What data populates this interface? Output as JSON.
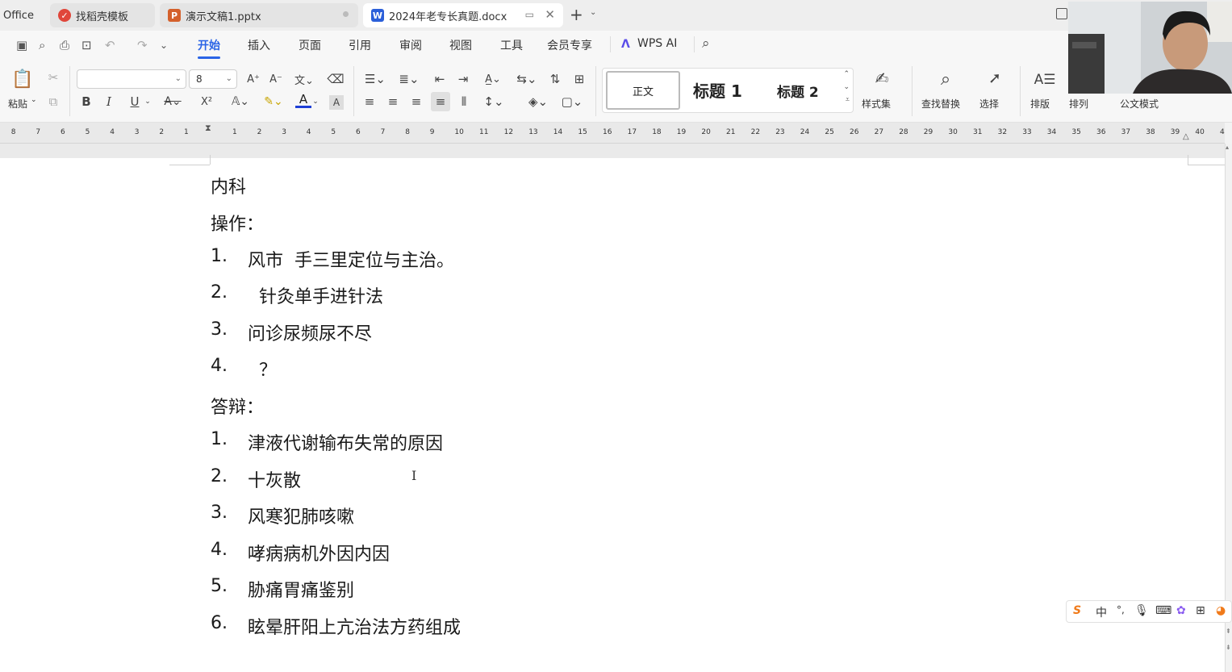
{
  "tabs": [
    {
      "label": "Office",
      "icon": "office-icon"
    },
    {
      "label": "找稻壳模板",
      "icon": "docer-icon"
    },
    {
      "label": "演示文稿1.pptx",
      "icon": "ppt-icon"
    },
    {
      "label": "2024年老专长真题.docx",
      "icon": "word-icon"
    }
  ],
  "new_tab_symbol": "+",
  "menu": [
    "开始",
    "插入",
    "页面",
    "引用",
    "审阅",
    "视图",
    "工具",
    "会员专享",
    "WPS AI"
  ],
  "ribbon": {
    "paste": "粘贴",
    "font_name": "",
    "font_size": "8",
    "styles": [
      "正文",
      "标题 1",
      "标题 2"
    ],
    "style_set": "样式集",
    "find_replace": "查找替换",
    "select": "选择",
    "layout": "排版",
    "arrange": "排列",
    "official_mode": "公文模式",
    "bold": "B",
    "italic": "I",
    "underline": "U",
    "font_color_glyph": "A",
    "superscript": "X²"
  },
  "ruler": {
    "left_numbers": [
      "8",
      "7",
      "6",
      "5",
      "4",
      "3",
      "2",
      "1"
    ],
    "right_numbers": [
      "1",
      "2",
      "3",
      "4",
      "5",
      "6",
      "7",
      "8",
      "9",
      "10",
      "11",
      "12",
      "13",
      "14",
      "15",
      "16",
      "17",
      "18",
      "19",
      "20",
      "21",
      "22",
      "23",
      "24",
      "25",
      "26",
      "27",
      "28",
      "29",
      "30",
      "31",
      "32",
      "33",
      "34",
      "35",
      "36",
      "37",
      "38",
      "39",
      "40",
      "4"
    ]
  },
  "document": {
    "heading1": "内科",
    "section1": "操作：",
    "list1": [
      {
        "num": "1.",
        "text": "风市  手三里定位与主治。"
      },
      {
        "num": "2.",
        "text": "  针灸单手进针法"
      },
      {
        "num": "3.",
        "text": "问诊尿频尿不尽"
      },
      {
        "num": "4.",
        "text": "  ？"
      }
    ],
    "section2": "答辩：",
    "list2": [
      {
        "num": "1.",
        "text": "津液代谢输布失常的原因"
      },
      {
        "num": "2.",
        "text": "十灰散"
      },
      {
        "num": "3.",
        "text": "风寒犯肺咳嗽"
      },
      {
        "num": "4.",
        "text": "哮病病机外因内因"
      },
      {
        "num": "5.",
        "text": "胁痛胃痛鉴别"
      },
      {
        "num": "6.",
        "text": "眩晕肝阳上亢治法方药组成"
      }
    ]
  },
  "ime": {
    "brand": "S",
    "lang": "中",
    "punct": "°,"
  },
  "colors": {
    "accent": "#2a64e6",
    "wps_red": "#e0463a",
    "ppt_orange": "#d4602b",
    "word_blue": "#2b5fd9"
  }
}
